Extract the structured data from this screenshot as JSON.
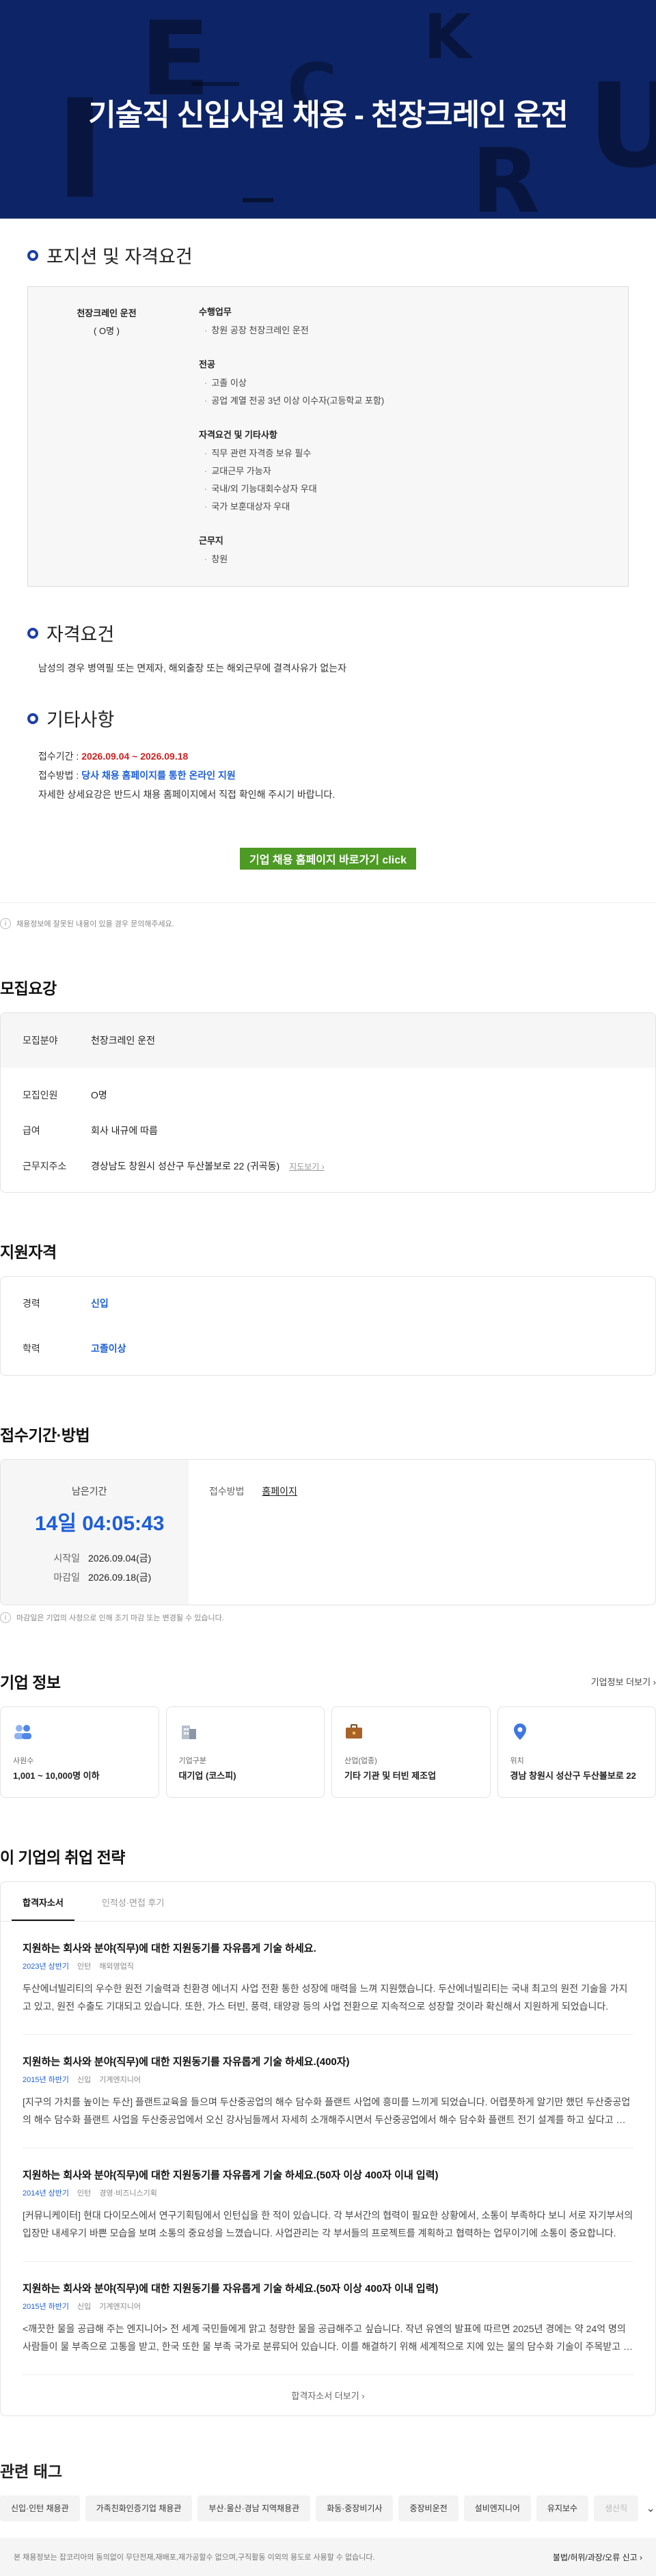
{
  "banner": {
    "title": "기술직 신입사원 채용 - 천장크레인 운전",
    "deco_letters": [
      "E",
      "I",
      "C",
      "K",
      "R",
      "R",
      "U"
    ]
  },
  "jd": {
    "position_title": "포지션 및 자격요건",
    "position_name": "천장크레인 운전",
    "position_count": "( O명 )",
    "groups": [
      {
        "title": "수행업무",
        "items": [
          "창원 공장 천장크레인 운전"
        ]
      },
      {
        "title": "전공",
        "items": [
          "고졸 이상",
          "공업 계열 전공 3년 이상 이수자(고등학교 포함)"
        ]
      },
      {
        "title": "자격요건 및 기타사항",
        "items": [
          "직무 관련 자격증 보유 필수",
          "교대근무 가능자",
          "국내/외 기능대회수상자 우대",
          "국가 보훈대상자 우대"
        ]
      },
      {
        "title": "근무지",
        "items": [
          "창원"
        ]
      }
    ],
    "qual_title": "자격요건",
    "qual_text": "남성의 경우 병역필 또는 면제자, 해외출장 또는 해외근무에 결격사유가 없는자",
    "etc_title": "기타사항",
    "period_label": "접수기간 : ",
    "period_value": "2026.09.04 ~ 2026.09.18",
    "method_label": "접수방법 : ",
    "method_value": "당사 채용 홈페이지를 통한 온라인 지원",
    "detail_text": "자세한 상세요강은 반드시 채용 홈페이지에서 직접 확인해 주시기 바랍니다.",
    "cta": "기업 채용 홈페이지 바로가기 click"
  },
  "report": {
    "icon": "i",
    "text": "채용정보에 잘못된 내용이 있을 경우 문의해주세요."
  },
  "recruit": {
    "title": "모집요강",
    "field_key": "모집분야",
    "field_value": "천장크레인 운전",
    "rows": [
      {
        "key": "모집인원",
        "value": "O명"
      },
      {
        "key": "급여",
        "value": "회사 내규에 따름"
      },
      {
        "key": "근무지주소",
        "value": "경상남도 창원시 성산구 두산볼보로 22 (귀곡동)"
      }
    ],
    "map_label": "지도보기 ›"
  },
  "qualification": {
    "title": "지원자격",
    "rows": [
      {
        "key": "경력",
        "value": "신입"
      },
      {
        "key": "학력",
        "value": "고졸이상"
      }
    ]
  },
  "period": {
    "title": "접수기간·방법",
    "remaining_label": "남은기간",
    "countdown": "14일 04:05:43",
    "start_key": "시작일",
    "start_value": "2026.09.04(금)",
    "end_key": "마감일",
    "end_value": "2026.09.18(금)",
    "method_key": "접수방법",
    "method_value": "홈페이지",
    "note": "마감일은 기업의 사정으로 인해 조기 마감 또는 변경될 수 있습니다."
  },
  "company": {
    "title": "기업 정보",
    "more": "기업정보 더보기 ›",
    "cards": [
      {
        "icon": "people-icon",
        "key": "사원수",
        "value": "1,001 ~ 10,000명 이하"
      },
      {
        "icon": "building-icon",
        "key": "기업구분",
        "value": "대기업 (코스피)"
      },
      {
        "icon": "briefcase-icon",
        "key": "산업(업종)",
        "value": "기타 기관 및 터빈 제조업"
      },
      {
        "icon": "pin-icon",
        "key": "위치",
        "value": "경남 창원시 성산구 두산볼보로 22"
      }
    ]
  },
  "strategy": {
    "title": "이 기업의 취업 전략",
    "tabs": [
      "합격자소서",
      "인적성·면접 후기"
    ],
    "items": [
      {
        "q": "지원하는 회사와 분야(직무)에 대한 지원동기를 자유롭게 기술 하세요.",
        "year": "2023년 상반기",
        "level": "인턴",
        "dept": "해외영업직",
        "a": "두산에너빌리티의 우수한 원전 기술력과 친환경 에너지 사업 전환 통한 성장에 매력을 느껴 지원했습니다. 두산에너빌리티는 국내 최고의 원전 기술을 가지고 있고, 원전 수출도 기대되고 있습니다. 또한, 가스 터빈, 풍력, 태양광 등의 사업 전환으로 지속적으로 성장할 것이라 확신해서 지원하게 되었습니다."
      },
      {
        "q": "지원하는 회사와 분야(직무)에 대한 지원동기를 자유롭게 기술 하세요.(400자)",
        "year": "2015년 하반기",
        "level": "신입",
        "dept": "기계엔지니어",
        "a": "[지구의 가치를 높이는 두산] 플랜트교육을 들으며 두산중공업의 해수 담수화 플랜트 사업에 흥미를 느끼게 되었습니다. 어렵풋하게 알기만 했던 두산중공업의 해수 담수화 플랜트 사업을 두산중공업에서 오신 강사님들께서 자세히 소개해주시면서 두산중공업에서 해수 담수화 플랜트 전기 설계를 하고 싶다고 생각했습니다."
      },
      {
        "q": "지원하는 회사와 분야(직무)에 대한 지원동기를 자유롭게 기술 하세요.(50자 이상 400자 이내 입력)",
        "year": "2014년 상반기",
        "level": "인턴",
        "dept": "경영·비즈니스기획",
        "a": "[커뮤니케이터] 현대 다이모스에서 연구기획팀에서 인턴십을 한 적이 있습니다. 각 부서간의 협력이 필요한 상황에서, 소통이 부족하다 보니 서로 자기부서의 입장만 내세우기 바쁜 모습을 보며 소통의 중요성을 느꼈습니다. 사업관리는 각 부서들의 프로젝트를 계획하고 협력하는 업무이기에 소통이 중요합니다."
      },
      {
        "q": "지원하는 회사와 분야(직무)에 대한 지원동기를 자유롭게 기술 하세요.(50자 이상 400자 이내 입력)",
        "year": "2015년 하반기",
        "level": "신입",
        "dept": "기계엔지니어",
        "a": "<깨끗한 물을 공급해 주는 엔지니어> 전 세계 국민들에게 맑고 청량한 물을 공급해주고 싶습니다. 작년 유엔의 발표에 따르면 2025년 경에는 약 24억 명의 사람들이 물 부족으로 고통을 받고, 한국 또한 물 부족 국가로 분류되어 있습니다. 이를 해결하기 위해 세계적으로 지에 있는 물의 담수화 기술이 주목받고 있습니다."
      }
    ],
    "more": "합격자소서 더보기 ›"
  },
  "tags": {
    "title": "관련 태그",
    "items": [
      "신입·인턴 채용관",
      "가족친화인증기업 채용관",
      "부산·울산·경남 지역채용관",
      "화동·중장비기사",
      "중장비운전",
      "설비엔지니어",
      "유지보수",
      "생산직"
    ]
  },
  "footer": {
    "notice": "본 채용정보는 잡코리아의 동의없이 무단전재,재배포,재가공할수 없으며,구직활동 이외의 용도로 사용할 수 없습니다.",
    "report": "불법/허위/과장/오류 신고 ›"
  }
}
